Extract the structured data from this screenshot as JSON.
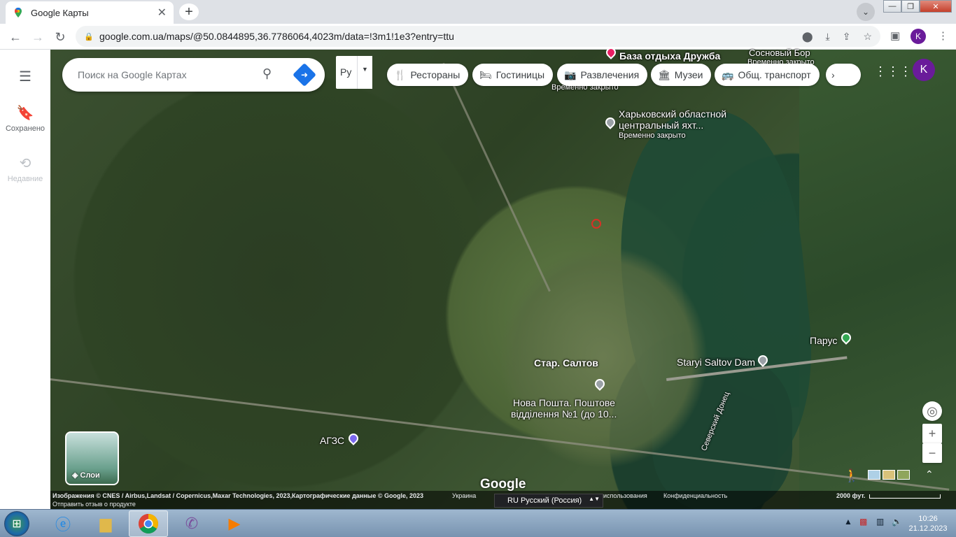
{
  "browser": {
    "tab_title": "Google Карты",
    "tab_close": "✕",
    "new_tab": "+",
    "url": "google.com.ua/maps/@50.0844895,36.7786064,4023m/data=!3m1!1e3?entry=ttu",
    "profile_initial": "K"
  },
  "sidebar": {
    "saved_label": "Сохранено",
    "recent_label": "Недавние"
  },
  "search": {
    "placeholder": "Поиск на Google Картах"
  },
  "lang_button": {
    "label": "Ру"
  },
  "chips": [
    {
      "label": "Рестораны",
      "icon": "restaurant-icon"
    },
    {
      "label": "Гостиницы",
      "icon": "hotel-icon"
    },
    {
      "label": "Развлечения",
      "icon": "camera-icon"
    },
    {
      "label": "Музеи",
      "icon": "museum-icon"
    },
    {
      "label": "Общ. транспорт",
      "icon": "transit-icon"
    }
  ],
  "account": {
    "initial": "K"
  },
  "map_labels": {
    "baza": "База отдыха Дружба",
    "sosnovy": "Сосновый Бор",
    "sosnovy_status": "Временно закрыто",
    "closed_top": "Временно закрыто",
    "yacht_line1": "Харьковский областной",
    "yacht_line2": "центральный яхт...",
    "yacht_status": "Временно закрыто",
    "town": "Стар. Салтов",
    "dam": "Staryi Saltov Dam",
    "parus": "Парус",
    "post_line1": "Нова Пошта. Поштове",
    "post_line2": "відділення №1 (до 10...",
    "agzs": "АГЗС",
    "river": "Северский Донец"
  },
  "layers": {
    "label": "Слои"
  },
  "google_logo": "Google",
  "footer": {
    "imagery": "Изображения © CNES / Airbus,Landsat / Copernicus,Maxar Technologies, 2023,Картографические данные © Google, 2023",
    "country": "Украина",
    "terms": "использования",
    "privacy": "Конфиденциальность",
    "feedback": "Отправить отзыв о продукте",
    "scale": "2000 фут."
  },
  "language_select": "RU Русский (Россия)",
  "taskbar": {
    "time": "10:26",
    "date": "21.12.2023"
  },
  "colors": {
    "accent": "#1a73e8",
    "avatar": "#6a1b9a"
  }
}
